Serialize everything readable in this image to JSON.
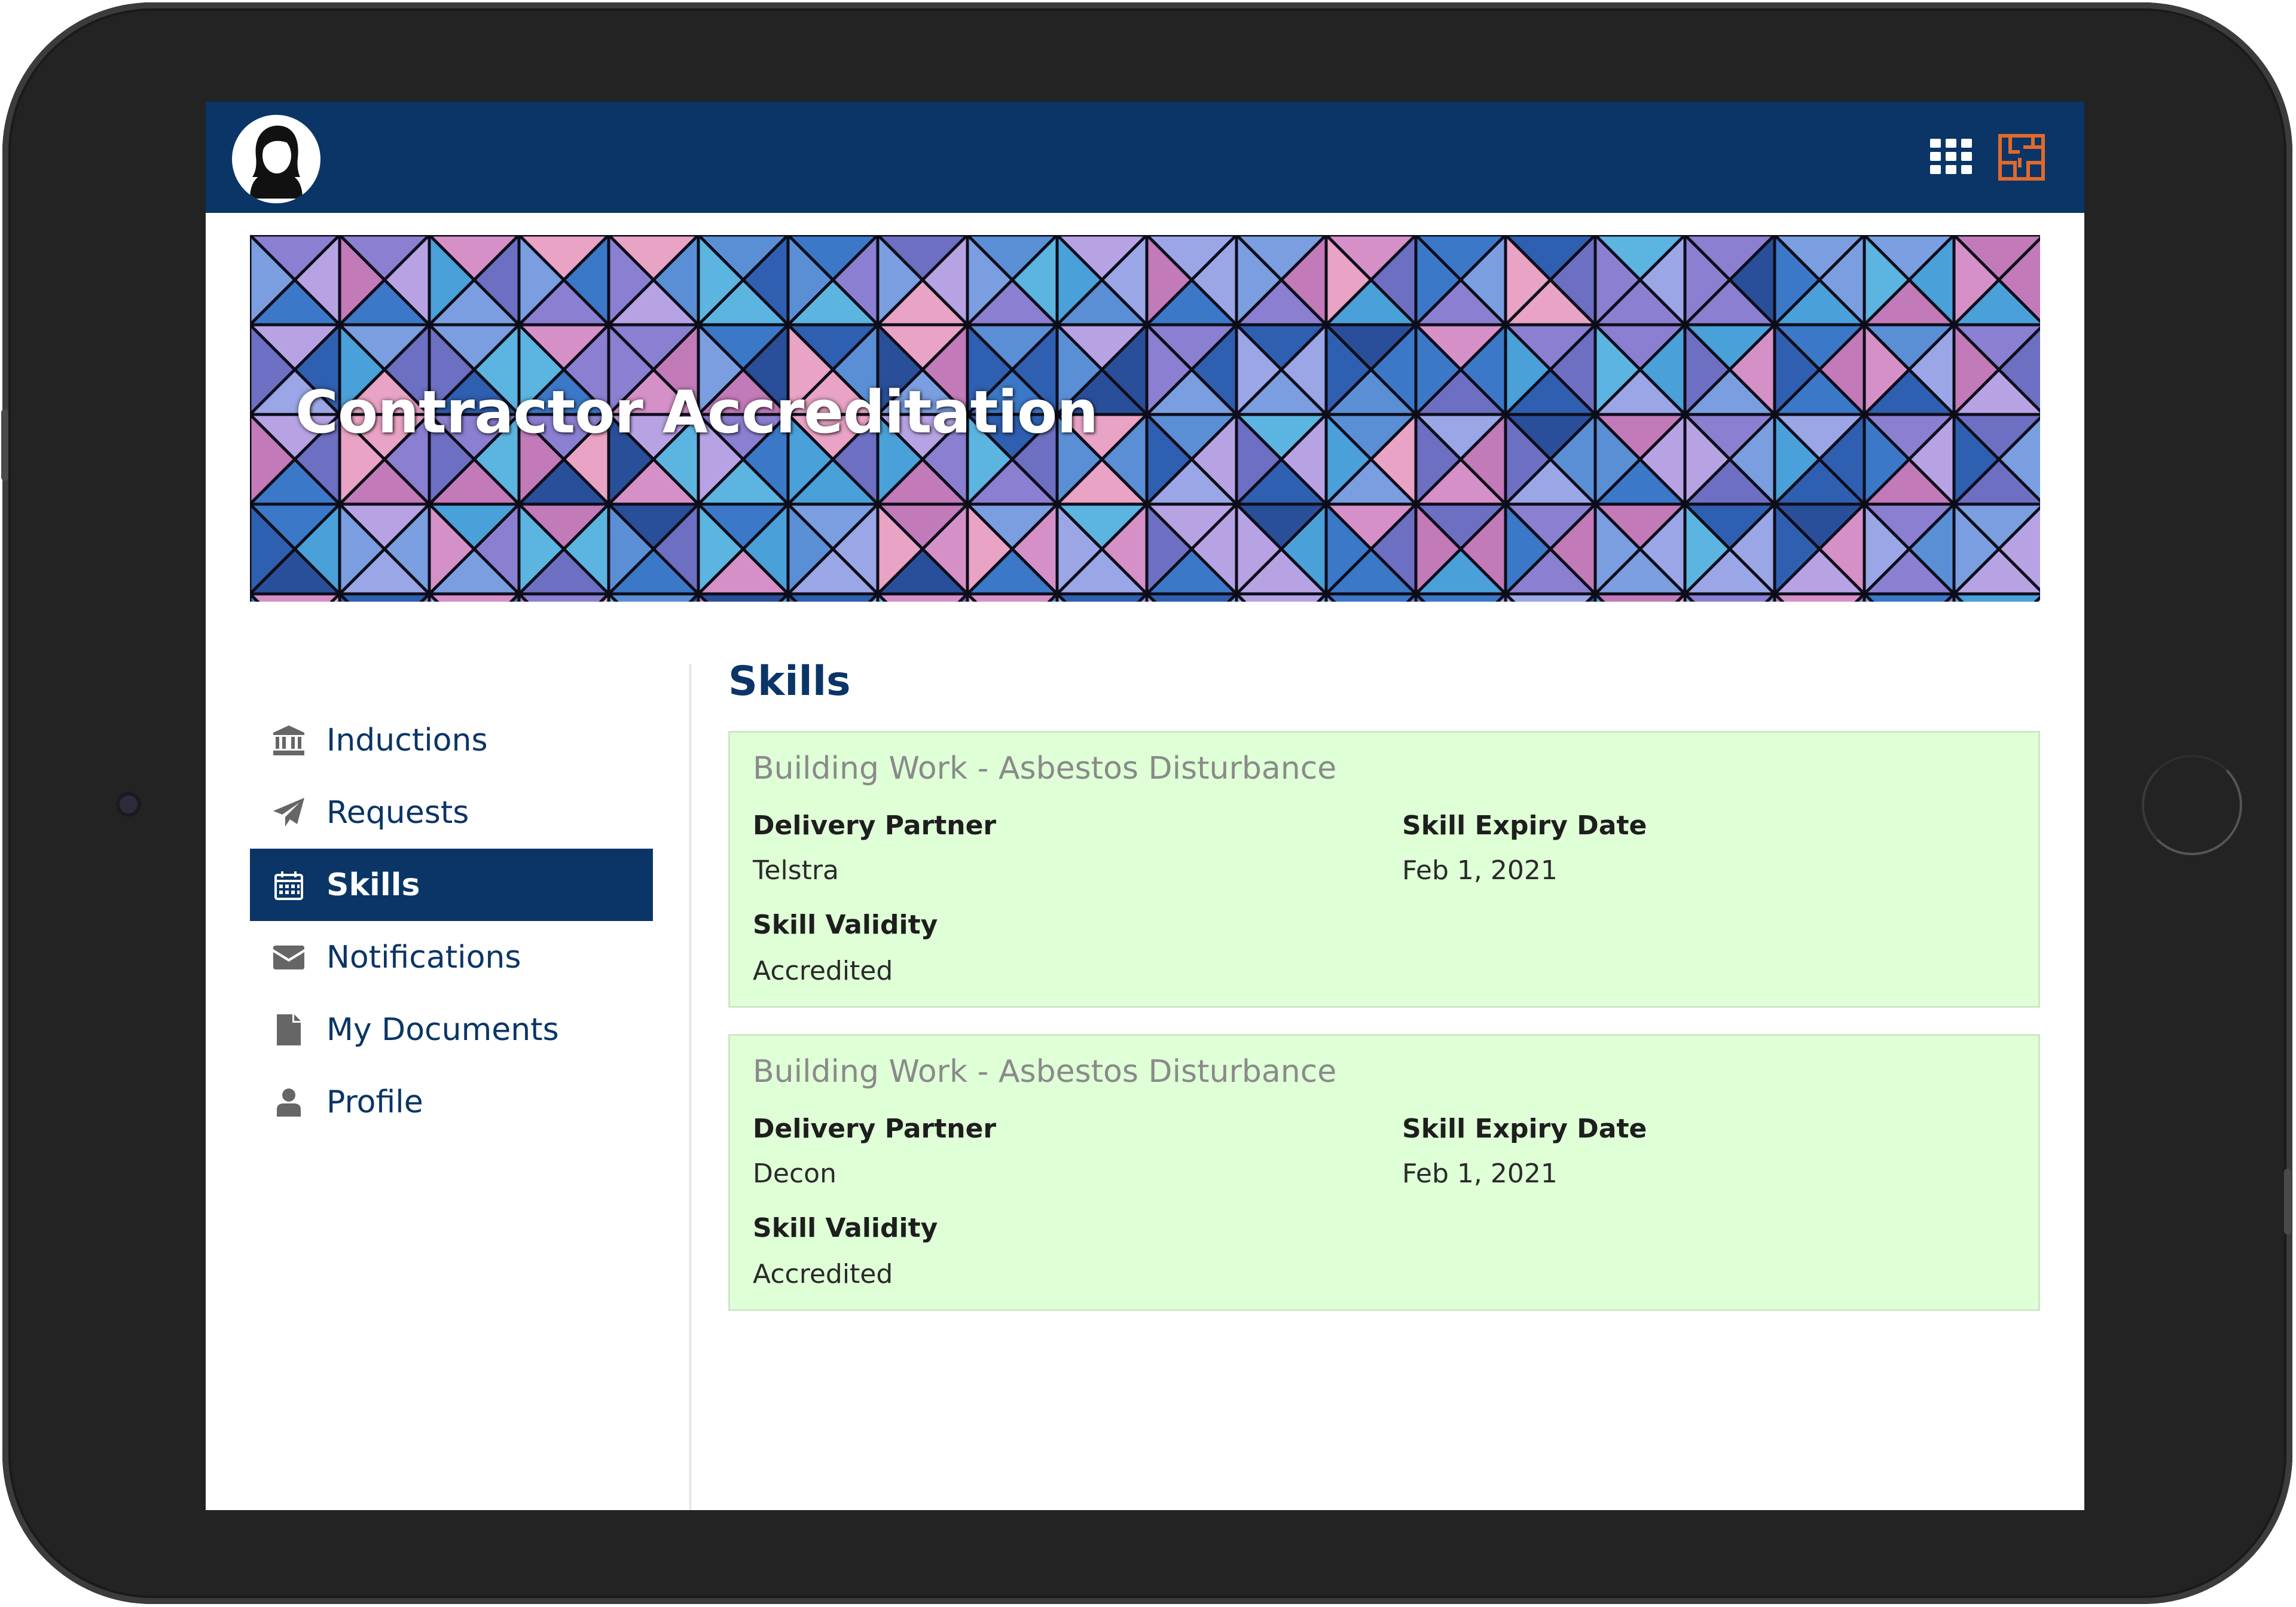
{
  "banner": {
    "title": "Contractor Accreditation"
  },
  "sidebar": {
    "items": [
      {
        "label": "Inductions",
        "icon": "institution-icon",
        "active": false
      },
      {
        "label": "Requests",
        "icon": "paper-plane-icon",
        "active": false
      },
      {
        "label": "Skills",
        "icon": "calendar-icon",
        "active": true
      },
      {
        "label": "Notifications",
        "icon": "envelope-icon",
        "active": false
      },
      {
        "label": "My Documents",
        "icon": "file-icon",
        "active": false
      },
      {
        "label": "Profile",
        "icon": "user-icon",
        "active": false
      }
    ]
  },
  "main": {
    "title": "Skills",
    "cards": [
      {
        "title": "Building Work - Asbestos Disturbance",
        "delivery_partner_label": "Delivery Partner",
        "delivery_partner": "Telstra",
        "expiry_label": "Skill Expiry Date",
        "expiry": "Feb 1, 2021",
        "validity_label": "Skill Validity",
        "validity": "Accredited"
      },
      {
        "title": "Building Work - Asbestos Disturbance",
        "delivery_partner_label": "Delivery Partner",
        "delivery_partner": "Decon",
        "expiry_label": "Skill Expiry Date",
        "expiry": "Feb 1, 2021",
        "validity_label": "Skill Validity",
        "validity": "Accredited"
      }
    ]
  },
  "colors": {
    "navy": "#0a3566",
    "card_bg": "#dfffd7",
    "brand_orange": "#e06a2c",
    "frame": "#232323"
  }
}
